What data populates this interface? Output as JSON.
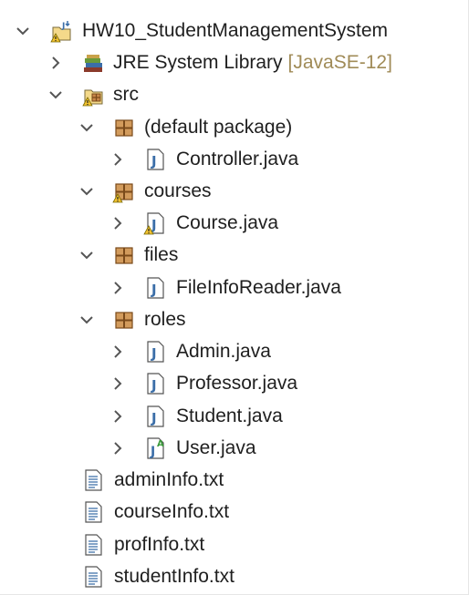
{
  "project": {
    "name": "HW10_StudentManagementSystem",
    "icon": "java-project-warning-icon",
    "children_expanded": true
  },
  "jre": {
    "label": "JRE System Library",
    "decoration": "[JavaSE-12]",
    "icon": "library-books-icon",
    "expanded": false
  },
  "src": {
    "label": "src",
    "icon": "source-folder-warning-icon",
    "expanded": true,
    "packages": [
      {
        "label": "(default package)",
        "icon": "package-icon",
        "expanded": true,
        "files": [
          {
            "label": "Controller.java",
            "icon": "java-file-icon"
          }
        ]
      },
      {
        "label": "courses",
        "icon": "package-warning-icon",
        "expanded": true,
        "files": [
          {
            "label": "Course.java",
            "icon": "java-file-warning-icon"
          }
        ]
      },
      {
        "label": "files",
        "icon": "package-icon",
        "expanded": true,
        "files": [
          {
            "label": "FileInfoReader.java",
            "icon": "java-file-icon"
          }
        ]
      },
      {
        "label": "roles",
        "icon": "package-icon",
        "expanded": true,
        "files": [
          {
            "label": "Admin.java",
            "icon": "java-file-icon"
          },
          {
            "label": "Professor.java",
            "icon": "java-file-icon"
          },
          {
            "label": "Student.java",
            "icon": "java-file-icon"
          },
          {
            "label": "User.java",
            "icon": "java-abstract-file-icon"
          }
        ]
      }
    ]
  },
  "text_files": [
    {
      "label": "adminInfo.txt",
      "icon": "text-file-icon"
    },
    {
      "label": "courseInfo.txt",
      "icon": "text-file-icon"
    },
    {
      "label": "profInfo.txt",
      "icon": "text-file-icon"
    },
    {
      "label": "studentInfo.txt",
      "icon": "text-file-icon"
    }
  ],
  "colors": {
    "decoration": "#a08b57",
    "package_brown": "#8a5a2b",
    "java_blue": "#3b6ea8",
    "warning_yellow": "#f2c230"
  }
}
